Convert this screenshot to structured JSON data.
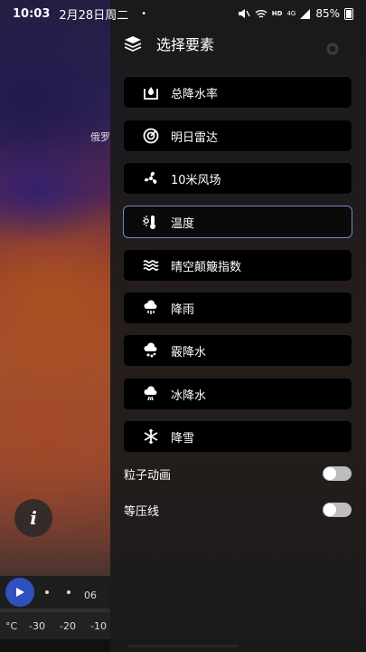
{
  "status_bar": {
    "time": "10:03",
    "date": "2月28日周二",
    "dot": "•",
    "hd": "HD",
    "signal_gen": "4G",
    "battery": "85%"
  },
  "map": {
    "place_label": "俄罗"
  },
  "drawer": {
    "title": "选择要素",
    "items": [
      {
        "label": "总降水率",
        "icon": "precip-total-icon",
        "active": false
      },
      {
        "label": "明日雷达",
        "icon": "radar-icon",
        "active": false
      },
      {
        "label": "10米风场",
        "icon": "fan-icon",
        "active": false
      },
      {
        "label": "温度",
        "icon": "thermometer-icon",
        "active": true
      },
      {
        "label": "晴空颠簸指数",
        "icon": "waves-icon",
        "active": false
      },
      {
        "label": "降雨",
        "icon": "rain-cloud-icon",
        "active": false
      },
      {
        "label": "霰降水",
        "icon": "graupel-icon",
        "active": false
      },
      {
        "label": "冰降水",
        "icon": "ice-cloud-icon",
        "active": false
      },
      {
        "label": "降雪",
        "icon": "snowflake-icon",
        "active": false
      }
    ],
    "toggles": [
      {
        "label": "粒子动画",
        "on": false
      },
      {
        "label": "等压线",
        "on": false
      }
    ]
  },
  "timeline": {
    "hour": "06"
  },
  "scale": {
    "unit": "°C",
    "ticks": [
      "-30",
      "-20",
      "-10"
    ]
  },
  "colors": {
    "drawer_bg": "#1a1a1a",
    "item_bg": "#000000",
    "active_border": "#7a85c8",
    "play_button": "#3050c0"
  }
}
